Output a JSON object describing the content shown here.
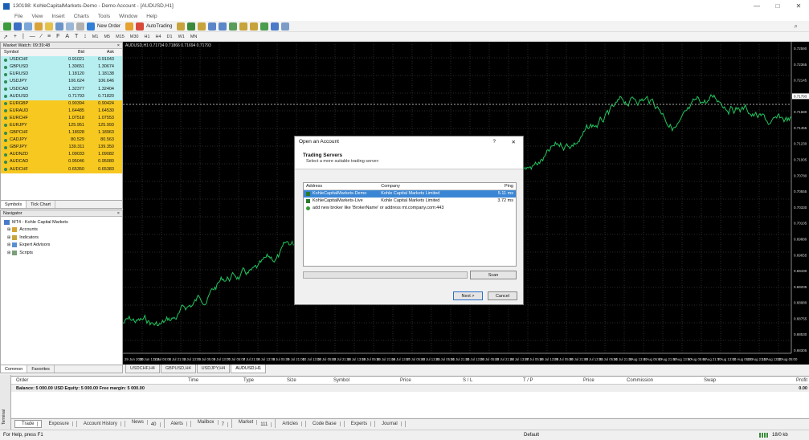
{
  "window": {
    "title": "130198: KohleCapitalMarkets-Demo - Demo Account - [AUDUSD,H1]",
    "min": "—",
    "max": "□",
    "close": "✕"
  },
  "menu": [
    "File",
    "View",
    "Insert",
    "Charts",
    "Tools",
    "Window",
    "Help"
  ],
  "toolbar": {
    "new_order": "New Order",
    "autotrading": "AutoTrading"
  },
  "timeframes": [
    "M1",
    "M5",
    "M15",
    "M30",
    "H1",
    "H4",
    "D1",
    "W1",
    "MN"
  ],
  "market_watch": {
    "title": "Market Watch: 09:39:48",
    "headers": {
      "symbol": "Symbol",
      "bid": "Bid",
      "ask": "Ask"
    },
    "rows": [
      {
        "symbol": "USDCHF",
        "bid": "0.91021",
        "ask": "0.91043"
      },
      {
        "symbol": "GBPUSD",
        "bid": "1.30651",
        "ask": "1.30674"
      },
      {
        "symbol": "EURUSD",
        "bid": "1.18120",
        "ask": "1.18138"
      },
      {
        "symbol": "USDJPY",
        "bid": "106.624",
        "ask": "106.646"
      },
      {
        "symbol": "USDCAD",
        "bid": "1.32377",
        "ask": "1.32404"
      },
      {
        "symbol": "AUDUSD",
        "bid": "0.71793",
        "ask": "0.71820"
      },
      {
        "symbol": "EURGBP",
        "bid": "0.90394",
        "ask": "0.90424"
      },
      {
        "symbol": "EURAUD",
        "bid": "1.64485",
        "ask": "1.64530"
      },
      {
        "symbol": "EURCHF",
        "bid": "1.07518",
        "ask": "1.07553"
      },
      {
        "symbol": "EURJPY",
        "bid": "125.951",
        "ask": "125.993"
      },
      {
        "symbol": "GBPCHF",
        "bid": "1.18928",
        "ask": "1.18963"
      },
      {
        "symbol": "CADJPY",
        "bid": "80.529",
        "ask": "80.563"
      },
      {
        "symbol": "GBPJPY",
        "bid": "139.311",
        "ask": "139.350"
      },
      {
        "symbol": "AUDNZD",
        "bid": "1.09033",
        "ask": "1.09082"
      },
      {
        "symbol": "AUDCAD",
        "bid": "0.95046",
        "ask": "0.95080"
      },
      {
        "symbol": "AUDCHF",
        "bid": "0.65350",
        "ask": "0.65383"
      }
    ],
    "tabs": [
      "Symbols",
      "Tick Chart"
    ]
  },
  "navigator": {
    "title": "Navigator",
    "root": "MT4 - Kohle Capital Markets",
    "items": [
      "Accounts",
      "Indicators",
      "Expert Advisors",
      "Scripts"
    ],
    "tabs": [
      "Common",
      "Favorites"
    ]
  },
  "chart": {
    "info": "AUDUSD,H1  0.71734 0.71866 0.71694 0.71793",
    "price_labels": [
      "0.72590",
      "0.72365",
      "0.72145",
      "0.71793",
      "0.71680",
      "0.71455",
      "0.71230",
      "0.71005",
      "0.70780",
      "0.70555",
      "0.70330",
      "0.70105",
      "0.69880",
      "0.69655",
      "0.69430",
      "0.69205",
      "0.68980",
      "0.68755",
      "0.68530",
      "0.68305"
    ],
    "time_labels": [
      "29 Jun 2020",
      "30 Jun 13:00",
      "1 Jul 05:00",
      "1 Jul 21:00",
      "2 Jul 13:00",
      "3 Jul 05:00",
      "6 Jul 13:00",
      "7 Jul 05:00",
      "7 Jul 21:00",
      "8 Jul 13:00",
      "9 Jul 05:00",
      "9 Jul 21:00",
      "10 Jul 13:00",
      "13 Jul 05:00",
      "13 Jul 21:00",
      "14 Jul 13:00",
      "15 Jul 05:00",
      "15 Jul 21:00",
      "16 Jul 13:00",
      "17 Jul 05:00",
      "20 Jul 13:00",
      "21 Jul 05:00",
      "21 Jul 21:00",
      "22 Jul 13:00",
      "23 Jul 05:00",
      "23 Jul 21:00",
      "24 Jul 13:00",
      "27 Jul 05:00",
      "28 Jul 13:00",
      "29 Jul 05:00",
      "29 Jul 21:00",
      "30 Jul 13:00",
      "31 Jul 05:00",
      "31 Jul 21:00",
      "3 Aug 13:00",
      "4 Aug 05:00",
      "4 Aug 21:00",
      "5 Aug 13:00",
      "6 Aug 05:00",
      "6 Aug 21:00",
      "7 Aug 13:00",
      "10 Aug 05:00",
      "10 Aug 21:00",
      "11 Aug 13:00",
      "12 Aug 05:00"
    ],
    "tabs": [
      "USDCHF,H4",
      "GBPUSD,H4",
      "USDJPY,H4",
      "AUDUSD,H1"
    ]
  },
  "dialog": {
    "title": "Open an Account",
    "help": "?",
    "close": "✕",
    "heading": "Trading Servers",
    "subheading": "Select a more suitable trading server:",
    "columns": {
      "address": "Address",
      "company": "Company",
      "ping": "Ping"
    },
    "servers": [
      {
        "address": "KohleCapitalMarkets-Demo",
        "company": "Kohle Capital Markets Limited",
        "ping": "5.11 ms"
      },
      {
        "address": "KohleCapitalMarkets-Live",
        "company": "Kohle Capital Markets Limited",
        "ping": "3.72 ms"
      }
    ],
    "add_broker": "add new broker like 'BrokerName' or address mt.company.com:443",
    "scan": "Scan",
    "next": "Next >",
    "cancel": "Cancel"
  },
  "terminal": {
    "headers": [
      "Order",
      "Time",
      "Type",
      "Size",
      "Symbol",
      "Price",
      "S / L",
      "T / P",
      "Price",
      "Commission",
      "Swap",
      "Profit"
    ],
    "balance": "Balance: 5 000.00 USD  Equity: 5 000.00  Free margin: 5 000.00",
    "profit": "0.00",
    "side_label": "Terminal",
    "tabs": [
      {
        "label": "Trade",
        "badge": ""
      },
      {
        "label": "Exposure",
        "badge": ""
      },
      {
        "label": "Account History",
        "badge": ""
      },
      {
        "label": "News",
        "badge": "40"
      },
      {
        "label": "Alerts",
        "badge": ""
      },
      {
        "label": "Mailbox",
        "badge": "7"
      },
      {
        "label": "Market",
        "badge": "111"
      },
      {
        "label": "Articles",
        "badge": ""
      },
      {
        "label": "Code Base",
        "badge": ""
      },
      {
        "label": "Experts",
        "badge": ""
      },
      {
        "label": "Journal",
        "badge": ""
      }
    ]
  },
  "status": {
    "help": "For Help, press F1",
    "profile": "Default",
    "traffic": "18/0 kb"
  }
}
